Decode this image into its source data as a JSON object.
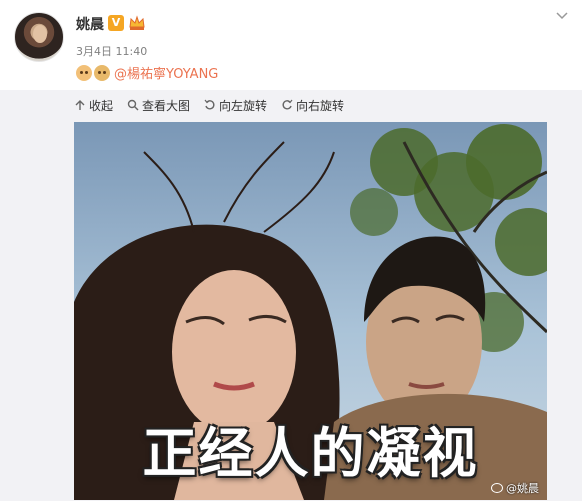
{
  "post": {
    "author": "姚晨",
    "date": "3月4日 11:40",
    "mention": "@楊祐寧YOYANG",
    "emoji_icons": [
      "dog-emoji-icon",
      "doge-emoji-icon"
    ]
  },
  "toolbar": {
    "collapse_label": "收起",
    "view_full_label": "查看大图",
    "rotate_left_label": "向左旋转",
    "rotate_right_label": "向右旋转"
  },
  "photo": {
    "caption": "正经人的凝视",
    "watermark": "@姚晨"
  },
  "colors": {
    "mention": "#eb7350",
    "verified": "#f5a623",
    "panel_bg": "#f2f2f5"
  }
}
